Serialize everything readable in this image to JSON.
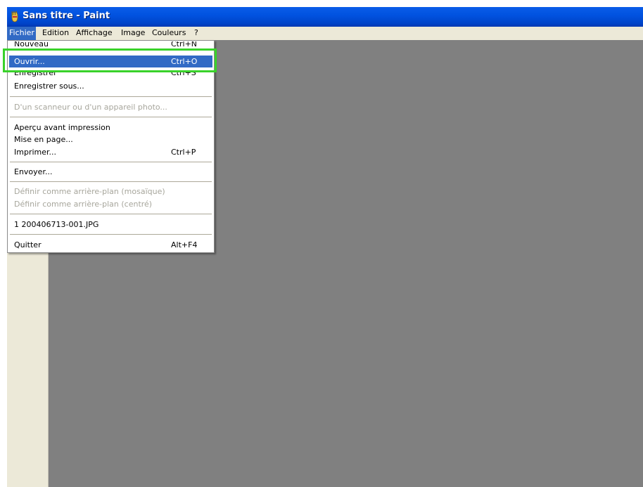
{
  "window": {
    "title": "Sans titre - Paint",
    "icon": "paint-app-icon"
  },
  "menubar": {
    "items": [
      {
        "label": "Fichier"
      },
      {
        "label": "Edition"
      },
      {
        "label": "Affichage"
      },
      {
        "label": "Image"
      },
      {
        "label": "Couleurs"
      },
      {
        "label": "?"
      }
    ]
  },
  "file_menu": {
    "items": [
      {
        "label": "Nouveau",
        "shortcut": "Ctrl+N"
      },
      {
        "label": "Ouvrir...",
        "shortcut": "Ctrl+O"
      },
      {
        "label": "Enregistrer",
        "shortcut": "Ctrl+S"
      },
      {
        "label": "Enregistrer sous..."
      },
      {
        "label": "D'un scanneur ou d'un appareil photo..."
      },
      {
        "label": "Aperçu avant impression"
      },
      {
        "label": "Mise en page..."
      },
      {
        "label": "Imprimer...",
        "shortcut": "Ctrl+P"
      },
      {
        "label": "Envoyer..."
      },
      {
        "label": "Définir comme arrière-plan (mosaïque)"
      },
      {
        "label": "Définir comme arrière-plan (centré)"
      },
      {
        "label": "1 200406713-001.JPG"
      },
      {
        "label": "Quitter",
        "shortcut": "Alt+F4"
      }
    ]
  },
  "colors": {
    "titlebar": "#0153e0",
    "menu_highlight": "#316ac5",
    "annotation_box": "#39d22a",
    "canvas_background": "#808080",
    "chrome": "#ece9d8"
  }
}
